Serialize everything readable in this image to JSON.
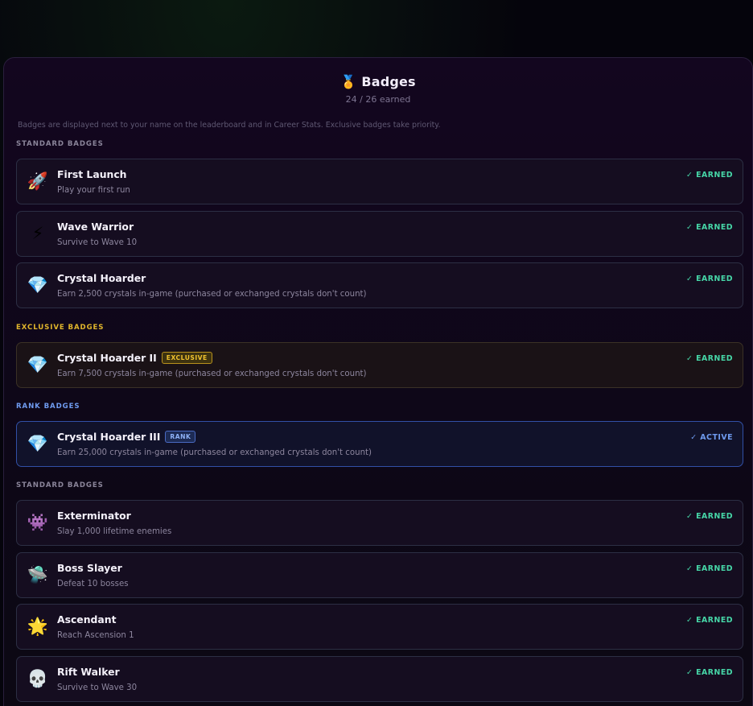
{
  "header": {
    "icon": "medal-icon",
    "title": "Badges",
    "earned_count": "24 / 26 earned"
  },
  "note": "Badges are displayed next to your name on the leaderboard and in Career Stats. Exclusive badges take priority.",
  "sections": {
    "standard_1": "STANDARD BADGES",
    "exclusive": "EXCLUSIVE BADGES",
    "rank": "RANK BADGES",
    "standard_2": "STANDARD BADGES"
  },
  "badges": [
    {
      "icon": "rocket-icon",
      "glyph": "🚀",
      "name": "First Launch",
      "desc": "Play your first run",
      "status": "✓ EARNED"
    },
    {
      "icon": "lightning-icon",
      "glyph": "⚡",
      "name": "Wave Warrior",
      "desc": "Survive to Wave 10",
      "status": "✓ EARNED"
    },
    {
      "icon": "gem-icon",
      "glyph": "💎",
      "name": "Crystal Hoarder",
      "desc": "Earn 2,500 crystals in-game (purchased or exchanged crystals don't count)",
      "status": "✓ EARNED"
    },
    {
      "icon": "gem-icon",
      "glyph": "💎",
      "name": "Crystal Hoarder II",
      "tag": "EXCLUSIVE",
      "desc": "Earn 7,500 crystals in-game (purchased or exchanged crystals don't count)",
      "status": "✓ EARNED"
    },
    {
      "icon": "gem-icon",
      "glyph": "💎",
      "name": "Crystal Hoarder III",
      "tag": "RANK",
      "desc": "Earn 25,000 crystals in-game (purchased or exchanged crystals don't count)",
      "status": "✓ ACTIVE"
    },
    {
      "icon": "alien-monster-icon",
      "glyph": "👾",
      "name": "Exterminator",
      "desc": "Slay 1,000 lifetime enemies",
      "status": "✓ EARNED"
    },
    {
      "icon": "ufo-icon",
      "glyph": "🛸",
      "name": "Boss Slayer",
      "desc": "Defeat 10 bosses",
      "status": "✓ EARNED"
    },
    {
      "icon": "star-icon",
      "glyph": "🌟",
      "name": "Ascendant",
      "desc": "Reach Ascension 1",
      "status": "✓ EARNED"
    },
    {
      "icon": "skull-icon",
      "glyph": "💀",
      "name": "Rift Walker",
      "desc": "Survive to Wave 30",
      "status": "✓ EARNED"
    }
  ],
  "colors": {
    "earned": "#46d6a7",
    "active": "#6f9bef",
    "exclusive": "#e0b52c",
    "rank": "#6f9bef"
  }
}
